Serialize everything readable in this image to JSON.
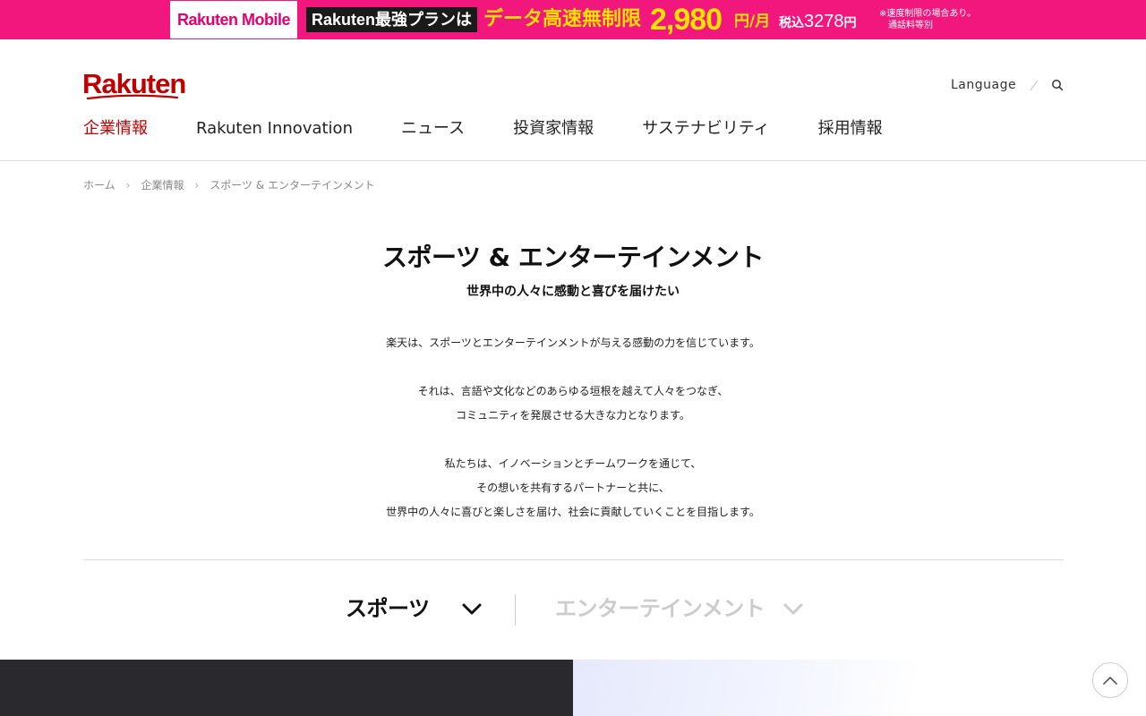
{
  "banner": {
    "mobile_logo": "Rakuten Mobile",
    "plan": "Rakuten最強プランは",
    "headline": "データ高速無制限",
    "price": "2,980",
    "unit": "円/月",
    "tax_prefix": "税込",
    "tax_amount": "3278",
    "tax_suffix": "円",
    "note_line1": "※速度制限の場合あり。",
    "note_line2": "通話料等別"
  },
  "header": {
    "logo": "Rakuten",
    "language": "Language",
    "nav": [
      "企業情報",
      "Rakuten Innovation",
      "ニュース",
      "投資家情報",
      "サステナビリティ",
      "採用情報"
    ],
    "active_index": 0
  },
  "breadcrumb": [
    "ホーム",
    "企業情報",
    "スポーツ & エンターテインメント"
  ],
  "main": {
    "title": "スポーツ & エンターテインメント",
    "subtitle": "世界中の人々に感動と喜びを届けたい",
    "paragraphs": [
      [
        "楽天は、スポーツとエンターテインメントが与える感動の力を信じています。"
      ],
      [
        "それは、言語や文化などのあらゆる垣根を越えて人々をつなぎ、",
        "コミュニティを発展させる大きな力となります。"
      ],
      [
        "私たちは、イノベーションとチームワークを通じて、",
        "その想いを共有するパートナーと共に、",
        "世界中の人々に喜びと楽しさを届け、社会に貢献していくことを目指します。"
      ]
    ]
  },
  "tabs": {
    "sports": "スポーツ",
    "entertainment": "エンターテインメント"
  },
  "colors": {
    "brand_red": "#bf0000",
    "banner_pink": "#f2177d",
    "banner_yellow": "#ffe100"
  },
  "icons": [
    "search-icon",
    "chevron-down-icon",
    "chevron-up-icon"
  ]
}
